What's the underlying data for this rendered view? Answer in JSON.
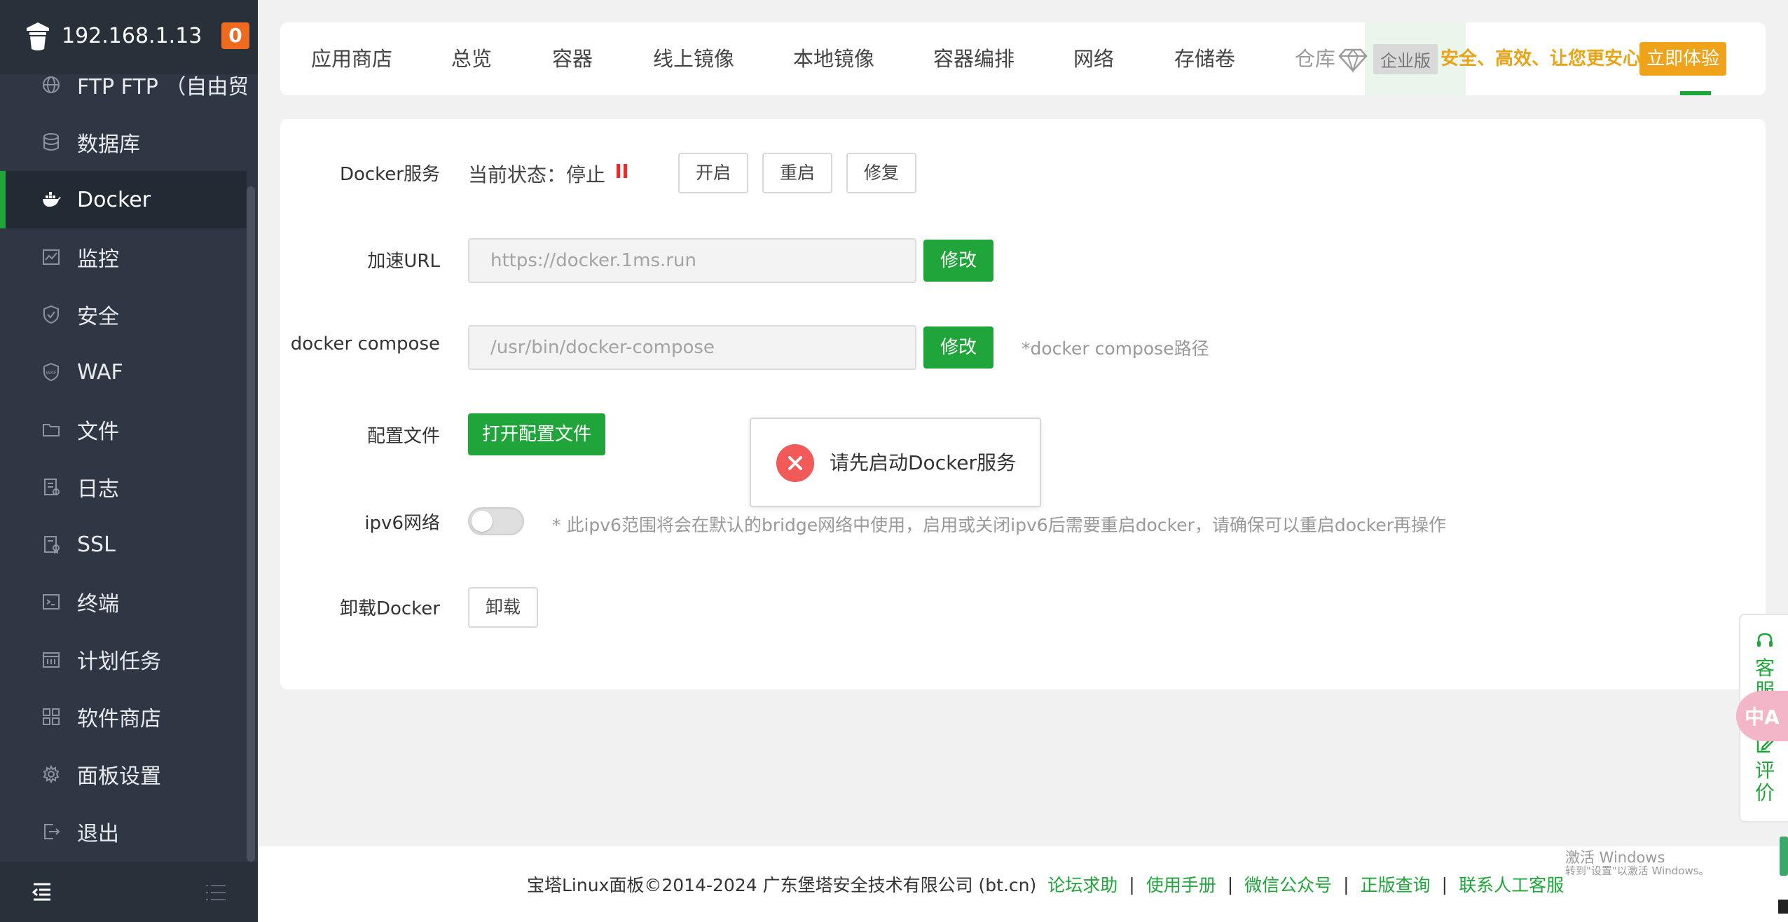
{
  "sidebar": {
    "host": "192.168.1.13",
    "badge": "0",
    "items": [
      {
        "label": "FTP FTP  （自由贸易",
        "icon": "globe-icon"
      },
      {
        "label": "数据库",
        "icon": "database-icon"
      },
      {
        "label": "Docker",
        "icon": "docker-icon",
        "active": true
      },
      {
        "label": "监控",
        "icon": "monitor-icon"
      },
      {
        "label": "安全",
        "icon": "shield-icon"
      },
      {
        "label": "WAF",
        "icon": "waf-shield-icon"
      },
      {
        "label": "文件",
        "icon": "folder-icon"
      },
      {
        "label": "日志",
        "icon": "log-icon"
      },
      {
        "label": "SSL",
        "icon": "certificate-icon"
      },
      {
        "label": "终端",
        "icon": "terminal-icon"
      },
      {
        "label": "计划任务",
        "icon": "calendar-icon"
      },
      {
        "label": "软件商店",
        "icon": "grid-icon"
      },
      {
        "label": "面板设置",
        "icon": "gear-icon"
      },
      {
        "label": "退出",
        "icon": "logout-icon"
      }
    ]
  },
  "tabs": [
    {
      "label": "应用商店"
    },
    {
      "label": "总览"
    },
    {
      "label": "容器"
    },
    {
      "label": "线上镜像"
    },
    {
      "label": "本地镜像"
    },
    {
      "label": "容器编排"
    },
    {
      "label": "网络"
    },
    {
      "label": "存储卷"
    },
    {
      "label": "仓库"
    }
  ],
  "enterprise": {
    "label": "企业版",
    "slogan": "安全、高效、让您更安心",
    "button": "立即体验",
    "accent": "#efa31a"
  },
  "docker": {
    "service_label": "Docker服务",
    "status_text": "当前状态：停止",
    "btn_start": "开启",
    "btn_restart": "重启",
    "btn_repair": "修复",
    "mirror_label": "加速URL",
    "mirror_value": "https://docker.1ms.run",
    "mirror_btn": "修改",
    "compose_label": "docker compose",
    "compose_value": "/usr/bin/docker-compose",
    "compose_btn": "修改",
    "compose_hint": "*docker compose路径",
    "config_label": "配置文件",
    "config_btn": "打开配置文件",
    "ipv6_label": "ipv6网络",
    "ipv6_enabled": false,
    "ipv6_hint": "* 此ipv6范围将会在默认的bridge网络中使用，启用或关闭ipv6后需要重启docker，请确保可以重启docker再操作",
    "uninstall_label": "卸载Docker",
    "uninstall_btn": "卸载"
  },
  "toast": {
    "message": "请先启动Docker服务",
    "icon": "error-x-icon"
  },
  "footer": {
    "copyright": "宝塔Linux面板©2014-2024 广东堡塔安全技术有限公司 (bt.cn)",
    "links": [
      "论坛求助",
      "使用手册",
      "微信公众号",
      "正版查询",
      "联系人工客服"
    ],
    "activate_title": "激活 Windows",
    "activate_sub": "转到\"设置\"以激活 Windows。"
  },
  "float_panel": {
    "service": "客服",
    "review": "评价",
    "bubble": "中A"
  },
  "colors": {
    "brand_green": "#20a53a",
    "sidebar_bg": "#2f3744",
    "error_red": "#f25a5a"
  }
}
